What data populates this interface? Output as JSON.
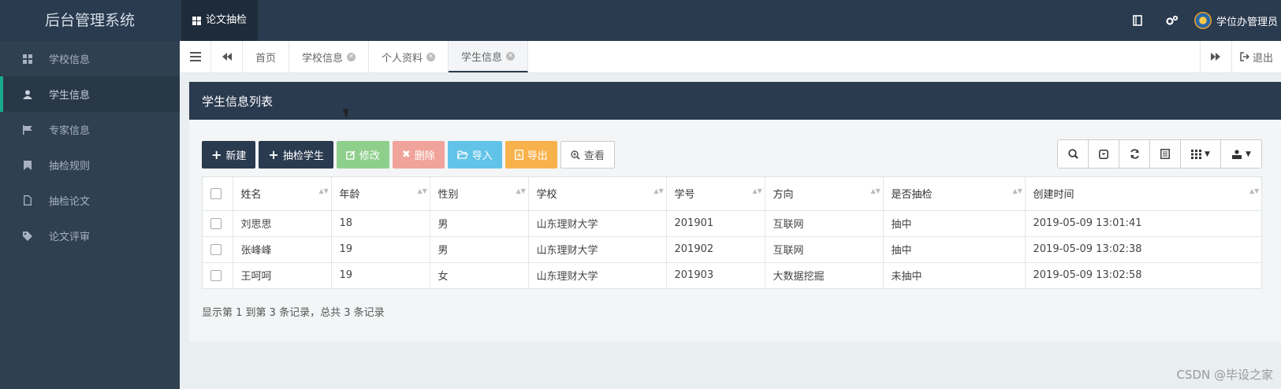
{
  "app": {
    "brand": "后台管理系统",
    "module": "论文抽检"
  },
  "topbar": {
    "icons": [
      "book-icon",
      "cogs-icon"
    ],
    "user": "学位办管理员"
  },
  "sidebar": {
    "items": [
      {
        "label": "学校信息",
        "icon": "th-large-icon",
        "active": false
      },
      {
        "label": "学生信息",
        "icon": "user-icon",
        "active": true
      },
      {
        "label": "专家信息",
        "icon": "flag-icon",
        "active": false
      },
      {
        "label": "抽检规则",
        "icon": "bookmark-icon",
        "active": false
      },
      {
        "label": "抽检论文",
        "icon": "file-icon",
        "active": false
      },
      {
        "label": "论文评审",
        "icon": "tags-icon",
        "active": false
      }
    ]
  },
  "tabs": {
    "items": [
      {
        "label": "首页",
        "closable": false
      },
      {
        "label": "学校信息",
        "closable": true
      },
      {
        "label": "个人资料",
        "closable": true
      },
      {
        "label": "学生信息",
        "closable": true,
        "active": true
      }
    ],
    "logout": "退出"
  },
  "panel": {
    "title": "学生信息列表",
    "buttons": {
      "new": "新建",
      "sample": "抽检学生",
      "edit": "修改",
      "delete": "删除",
      "import": "导入",
      "export": "导出",
      "view": "查看"
    }
  },
  "table": {
    "columns": [
      "姓名",
      "年龄",
      "性别",
      "学校",
      "学号",
      "方向",
      "是否抽检",
      "创建时间"
    ],
    "rows": [
      [
        "刘思思",
        "18",
        "男",
        "山东理财大学",
        "201901",
        "互联网",
        "抽中",
        "2019-05-09 13:01:41"
      ],
      [
        "张峰峰",
        "19",
        "男",
        "山东理财大学",
        "201902",
        "互联网",
        "抽中",
        "2019-05-09 13:02:38"
      ],
      [
        "王呵呵",
        "19",
        "女",
        "山东理财大学",
        "201903",
        "大数据挖掘",
        "未抽中",
        "2019-05-09 13:02:58"
      ]
    ],
    "summary": "显示第 1 到第 3 条记录，总共 3 条记录"
  },
  "watermark": "CSDN @毕设之家",
  "colors": {
    "header": "#2a3a4f",
    "sidebar": "#2f4050",
    "accent": "#19aa8d"
  }
}
